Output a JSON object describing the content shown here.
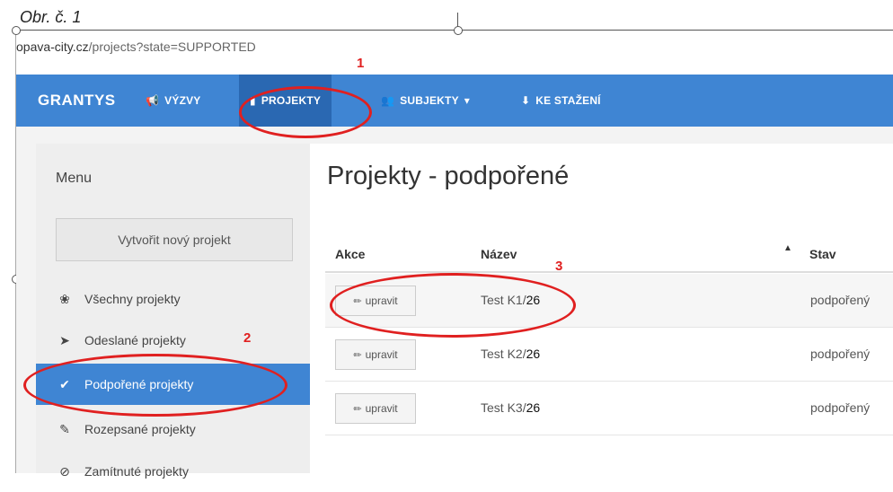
{
  "caption": "Obr. č. 1",
  "url": {
    "host": "opava-city.cz",
    "path": "/projects?state=SUPPORTED"
  },
  "navbar": {
    "brand": "GRANTYS",
    "items": [
      {
        "label": "VÝZVY",
        "icon": "bullhorn-icon"
      },
      {
        "label": "PROJEKTY",
        "icon": "file-icon",
        "active": true
      },
      {
        "label": "SUBJEKTY",
        "icon": "users-icon",
        "caret": "▾"
      },
      {
        "label": "KE STAŽENÍ",
        "icon": "download-icon"
      }
    ]
  },
  "sidebar": {
    "title": "Menu",
    "new_button": "Vytvořit nový projekt",
    "items": [
      {
        "label": "Všechny projekty",
        "icon": "cubes-icon"
      },
      {
        "label": "Odeslané projekty",
        "icon": "send-icon"
      },
      {
        "label": "Podpořené projekty",
        "icon": "check-icon",
        "active": true
      },
      {
        "label": "Rozepsané projekty",
        "icon": "pencil-icon"
      },
      {
        "label": "Zamítnuté projekty",
        "icon": "ban-icon"
      }
    ]
  },
  "main": {
    "title": "Projekty - podpořené",
    "columns": {
      "akce": "Akce",
      "nazev": "Název",
      "sort": "▲",
      "stav": "Stav"
    },
    "rows": [
      {
        "action": "upravit",
        "name": "Test K1/",
        "num": "26",
        "state": "podpořený"
      },
      {
        "action": "upravit",
        "name": "Test K2/",
        "num": "26",
        "state": "podpořený"
      },
      {
        "action": "upravit",
        "name": "Test K3/",
        "num": "26",
        "state": "podpořený"
      }
    ]
  },
  "annotations": {
    "one": "1",
    "two": "2",
    "three": "3",
    "color": "#e02020"
  },
  "colors": {
    "nav": "#3f85d3",
    "nav_active": "#2a68b2"
  }
}
